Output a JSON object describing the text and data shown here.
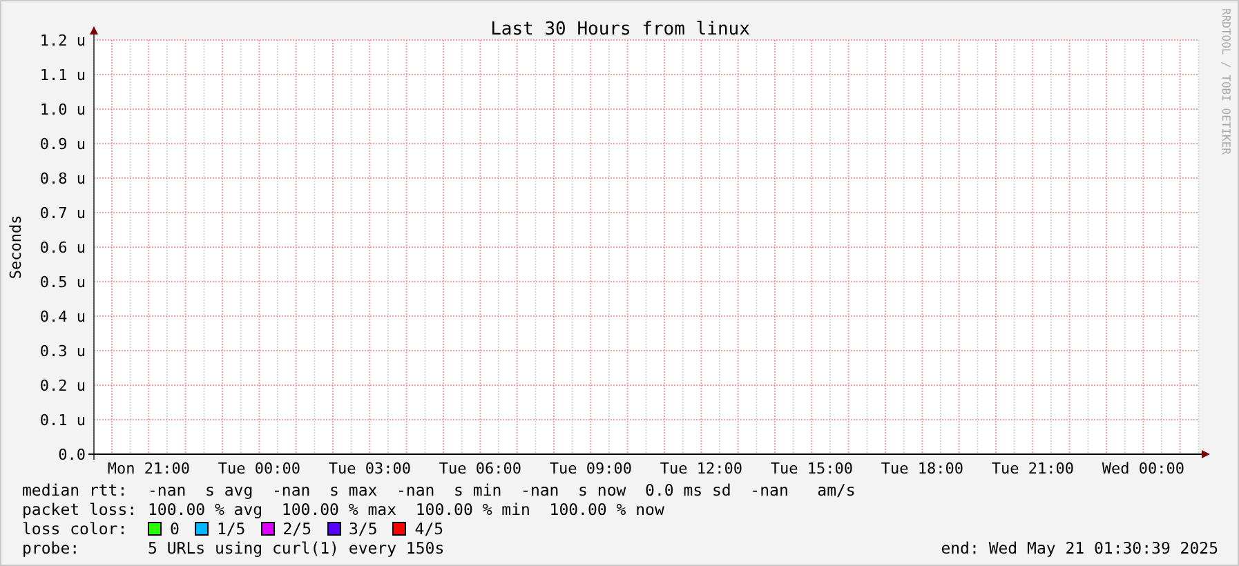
{
  "graph": {
    "chart_data": {
      "type": "line",
      "title": "Last 30 Hours from linux",
      "ylabel": "Seconds",
      "ylim": [
        0,
        1.2
      ],
      "grid": true,
      "yticks": [
        {
          "value": 0,
          "label": "0.0"
        },
        {
          "value": 0.1,
          "label": "0.1 u"
        },
        {
          "value": 0.2,
          "label": "0.2 u"
        },
        {
          "value": 0.3,
          "label": "0.3 u"
        },
        {
          "value": 0.4,
          "label": "0.4 u"
        },
        {
          "value": 0.5,
          "label": "0.5 u"
        },
        {
          "value": 0.6,
          "label": "0.6 u"
        },
        {
          "value": 0.7,
          "label": "0.7 u"
        },
        {
          "value": 0.8,
          "label": "0.8 u"
        },
        {
          "value": 0.9,
          "label": "0.9 u"
        },
        {
          "value": 1.0,
          "label": "1.0 u"
        },
        {
          "value": 1.1,
          "label": "1.1 u"
        },
        {
          "value": 1.2,
          "label": "1.2 u"
        }
      ],
      "categories": [
        null,
        "Mon 21:00",
        null,
        null,
        "Tue 00:00",
        null,
        null,
        "Tue 03:00",
        null,
        null,
        "Tue 06:00",
        null,
        null,
        "Tue 09:00",
        null,
        null,
        "Tue 12:00",
        null,
        null,
        "Tue 15:00",
        null,
        null,
        "Tue 18:00",
        null,
        null,
        "Tue 21:00",
        null,
        null,
        "Wed 00:00",
        null
      ]
    },
    "credit": "RRDTOOL / TOBI OETIKER"
  },
  "legend": [
    {
      "label": "median rtt:",
      "text": "-nan  s avg  -nan  s max  -nan  s min  -nan  s now  0.0 ms sd  -nan   am/s"
    },
    {
      "label": "packet loss:",
      "text": "100.00 % avg  100.00 % max  100.00 % min  100.00 % now"
    }
  ],
  "loss_color": {
    "label": "loss color:",
    "items": [
      {
        "label": "0",
        "color": "#26ff00"
      },
      {
        "label": "1/5",
        "color": "#00b8ff"
      },
      {
        "label": "2/5",
        "color": "#dd00ff"
      },
      {
        "label": "3/5",
        "color": "#5500ff"
      },
      {
        "label": "4/5",
        "color": "#ff0000"
      }
    ]
  },
  "probe": {
    "label": "probe:",
    "text": "5 URLs using curl(1) every 150s"
  },
  "end": "end: Wed May 21 01:30:39 2025"
}
